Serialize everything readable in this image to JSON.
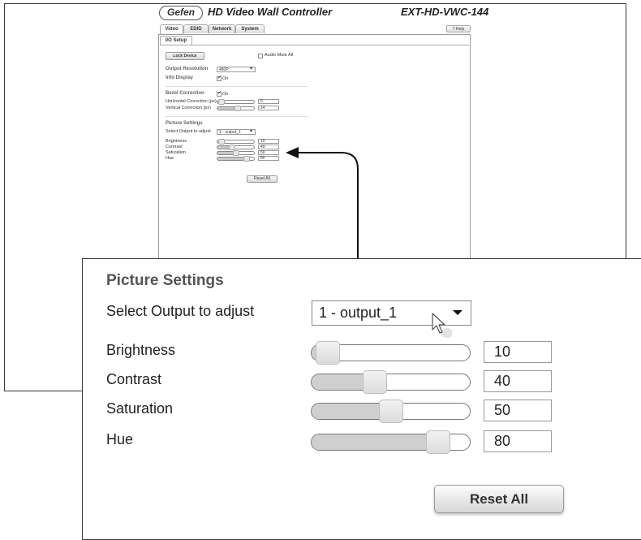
{
  "header": {
    "logo_text": "Gefen",
    "app_title": "HD Video Wall Controller",
    "model": "EXT-HD-VWC-144"
  },
  "tabs": [
    {
      "label": "Video",
      "active": true
    },
    {
      "label": "EDID",
      "active": false
    },
    {
      "label": "Network",
      "active": false
    },
    {
      "label": "System",
      "active": false
    }
  ],
  "help_label": "? Help",
  "subtab_label": "I/O Setup",
  "io_setup": {
    "lock_button": "Lock Device",
    "audio_mute_label": "Audio Mute All",
    "audio_mute_checked": false,
    "output_resolution_label": "Output Resolution",
    "output_resolution_value": "480P",
    "info_display_label": "Info Display",
    "info_display_checkbox_label": "On",
    "info_display_checked": true,
    "bezel_heading": "Bezel Correction",
    "bezel_checkbox_label": "On",
    "bezel_checked": true,
    "horizontal_label": "Horizontal Correction (px)",
    "horizontal_value": "5",
    "horizontal_fraction": 0.12,
    "vertical_label": "Vertical Correction (px)",
    "vertical_value": "14",
    "vertical_fraction": 0.55
  },
  "picture_settings": {
    "heading": "Picture Settings",
    "select_label": "Select Output to adjust",
    "select_value": "1 - output_1",
    "sliders": [
      {
        "label": "Brightness",
        "value": "10",
        "fraction": 0.1
      },
      {
        "label": "Contrast",
        "value": "40",
        "fraction": 0.4
      },
      {
        "label": "Saturation",
        "value": "50",
        "fraction": 0.5
      },
      {
        "label": "Hue",
        "value": "80",
        "fraction": 0.8
      }
    ],
    "reset_label": "Reset All"
  },
  "colors": {
    "frame": "#3a3a3a",
    "slider_fill": "#cfcfcf",
    "heading_gray": "#555555"
  }
}
